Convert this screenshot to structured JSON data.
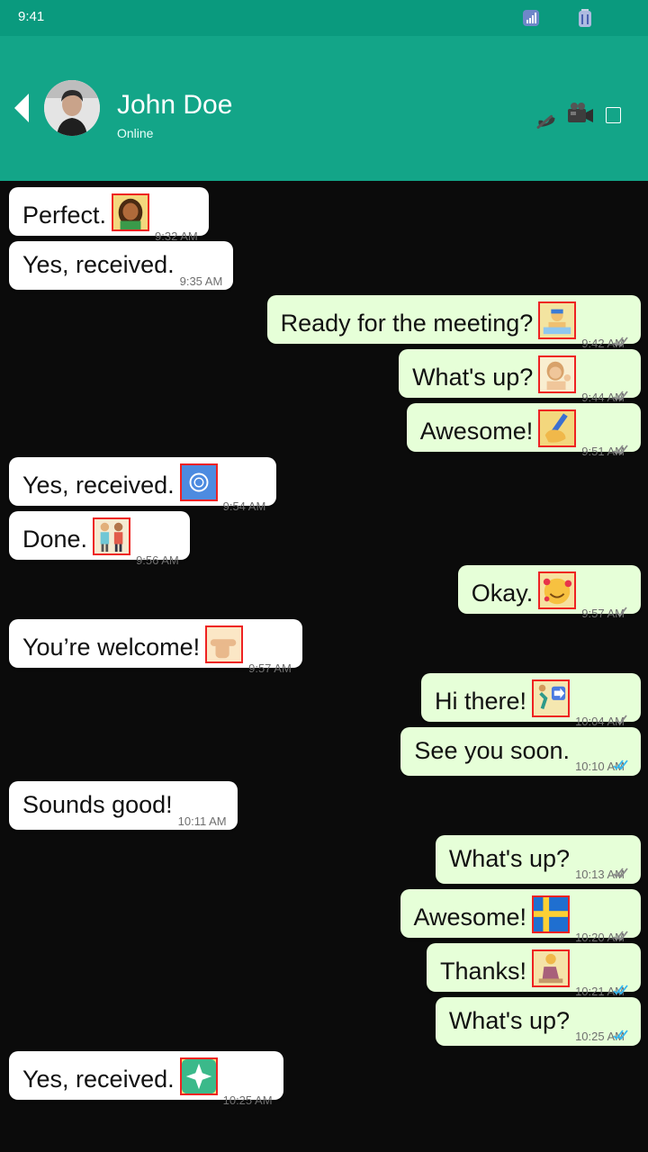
{
  "status_bar": {
    "time": "9:41"
  },
  "header": {
    "contact_name": "John Doe",
    "contact_status": "Online"
  },
  "colors": {
    "header_bg": "#13a588",
    "status_bar_bg": "#0a9a7e",
    "chat_bg": "#0b0b0b",
    "incoming_bubble": "#ffffff",
    "outgoing_bubble": "#e6ffd8",
    "read_tick": "#34b7f1",
    "unread_tick": "#8a8a8a"
  },
  "icons": {
    "back": "back-arrow-icon",
    "phone": "phone-icon",
    "video": "video-camera-icon",
    "menu": "menu-icon",
    "signal": "signal-icon",
    "battery": "battery-icon"
  },
  "messages": [
    {
      "dir": "in",
      "text": "Perfect.",
      "emoji": "woman-curly-hair-emoji",
      "time": "9:32 AM"
    },
    {
      "dir": "in",
      "text": "Yes, received.",
      "emoji": "",
      "time": "9:35 AM"
    },
    {
      "dir": "out",
      "text": "Ready for the meeting?",
      "emoji": "water-polo-player-emoji",
      "time": "9:42 AM",
      "status": "delivered"
    },
    {
      "dir": "out",
      "text": "What's up?",
      "emoji": "person-tipping-hand-emoji",
      "time": "9:44 AM",
      "status": "delivered"
    },
    {
      "dir": "out",
      "text": "Awesome!",
      "emoji": "writing-hand-emoji",
      "time": "9:51 AM",
      "status": "delivered"
    },
    {
      "dir": "in",
      "text": "Yes, received.",
      "emoji": "united-nations-flag-emoji",
      "time": "9:54 AM"
    },
    {
      "dir": "in",
      "text": "Done.",
      "emoji": "couple-holding-hands-emoji",
      "time": "9:56 AM"
    },
    {
      "dir": "out",
      "text": "Okay.",
      "emoji": "smiling-face-hearts-emoji",
      "time": "9:57 AM",
      "status": "sent"
    },
    {
      "dir": "in",
      "text": "You’re welcome!",
      "emoji": "pointing-right-emoji",
      "time": "9:57 AM"
    },
    {
      "dir": "out",
      "text": "Hi there!",
      "emoji": "person-running-arrow-emoji",
      "time": "10:04 AM",
      "status": "sent"
    },
    {
      "dir": "out",
      "text": "See you soon.",
      "emoji": "",
      "time": "10:10 AM",
      "status": "read"
    },
    {
      "dir": "in",
      "text": "Sounds good!",
      "emoji": "",
      "time": "10:11 AM"
    },
    {
      "dir": "out",
      "text": "What's up?",
      "emoji": "",
      "time": "10:13 AM",
      "status": "delivered"
    },
    {
      "dir": "out",
      "text": "Awesome!",
      "emoji": "sweden-flag-emoji",
      "time": "10:20 AM",
      "status": "delivered"
    },
    {
      "dir": "out",
      "text": "Thanks!",
      "emoji": "person-kneeling-emoji",
      "time": "10:21 AM",
      "status": "read"
    },
    {
      "dir": "out",
      "text": "What's up?",
      "emoji": "",
      "time": "10:25 AM",
      "status": "read"
    },
    {
      "dir": "in",
      "text": "Yes, received.",
      "emoji": "sparkle-emoji",
      "time": "10:25 AM"
    }
  ]
}
